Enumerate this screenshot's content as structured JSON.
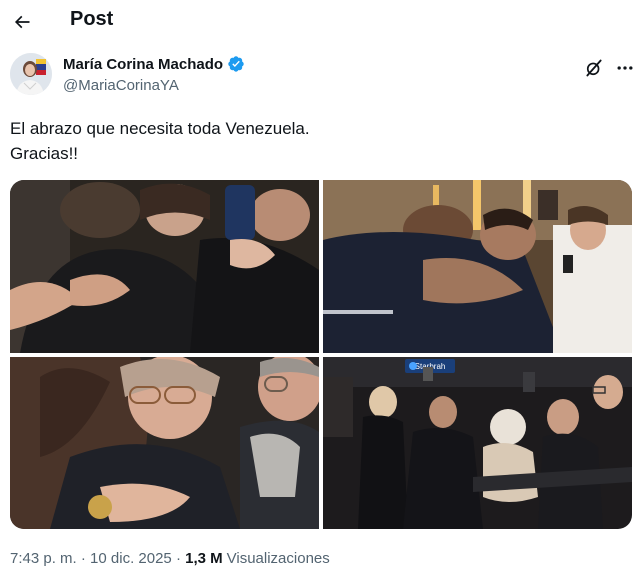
{
  "header": {
    "title": "Post",
    "back_icon": "arrow-left-icon"
  },
  "author": {
    "display_name": "María Corina Machado",
    "handle": "@MariaCorinaYA",
    "verified": true,
    "verified_color": "#1d9bf0"
  },
  "tweet": {
    "lines": [
      "El abrazo que necesita toda Venezuela.",
      "Gracias!!"
    ]
  },
  "media": {
    "photos": [
      {
        "description": "hug-photo-1"
      },
      {
        "description": "hug-photo-2"
      },
      {
        "description": "hug-photo-3"
      },
      {
        "description": "hug-photo-4"
      }
    ],
    "photo4_sign": "Starbrah"
  },
  "meta": {
    "time": "7:43 p. m.",
    "separator": " · ",
    "date": "10 dic. 2025",
    "views_count": "1,3 M",
    "views_label": "Visualizaciones"
  },
  "colors": {
    "text": "#0f1419",
    "secondary": "#536471",
    "accent": "#1d9bf0"
  }
}
